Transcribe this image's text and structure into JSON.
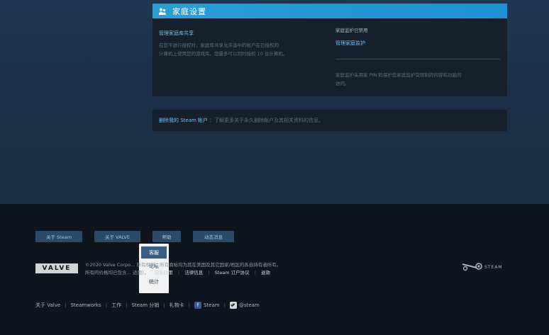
{
  "panel": {
    "title": "家庭设置",
    "left_link": "管理家庭库共享",
    "left_desc_line1": "在您不进行授权时，家庭库共享允许选中的帐户在已授权的",
    "left_desc_line2": "计算机上使用您的游戏库。您最多可以同时授权 10 台计算机。",
    "status": "家庭监护已禁用",
    "manage_link": "管理家庭监护",
    "note_line1": "家庭监护采用家 PIN 码保护您家庭监护受限制的内容和功能的",
    "note_line2": "访问。"
  },
  "delete_bar": {
    "link": "删除我的 Steam 帐户",
    "rest": "：了解更多关于永久删除帐户及其相关资料的信息。"
  },
  "footer": {
    "buttons": [
      "关于 Steam",
      "关于 VALVE",
      "帮助",
      "动态消息"
    ],
    "dropdown": [
      "客服",
      "论坛",
      "统计"
    ],
    "valve_logo_text": "VALVE",
    "copyright_line1": "©2020 Valve Corpo… 所有权利。所有商标均为其在美国及其它国家/地区的各自持有者所有。",
    "copyright_line2": "所有的价格均已包含… 适用）。",
    "legal_links": [
      "隐私政策",
      "法律信息",
      "Steam 订户协议",
      "退款"
    ],
    "steam_logo_text": "STEAM",
    "bottom_links": [
      "关于 Valve",
      "Steamworks",
      "工作",
      "Steam 分销",
      "礼物卡"
    ],
    "facebook_label": "Steam",
    "twitter_label": "@steam"
  },
  "colors": {
    "accent": "#1e90d6",
    "link": "#67c1f5",
    "footer_bg": "#0f151d"
  }
}
